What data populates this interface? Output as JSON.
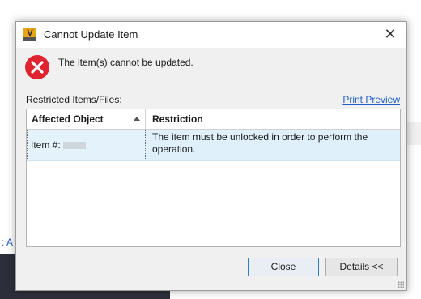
{
  "background": {
    "left_text": ":  A"
  },
  "dialog": {
    "title": "Cannot Update Item",
    "app_icon_letter": "V",
    "close_glyph": "✕",
    "message": "The item(s) cannot be updated.",
    "restricted_label": "Restricted Items/Files:",
    "print_preview": "Print Preview",
    "grid": {
      "columns": [
        "Affected Object",
        "Restriction"
      ],
      "rows": [
        {
          "affected_object": "Item #:",
          "restriction": "The item must be unlocked in order to perform the operation."
        }
      ]
    },
    "buttons": {
      "close": "Close",
      "details": "Details <<"
    }
  },
  "colors": {
    "accent": "#1e60c8",
    "error": "#e0242f",
    "selection": "#dff0fb"
  },
  "icons": [
    "app-logo-icon",
    "close-icon",
    "error-icon",
    "sort-ascending-icon",
    "resize-grip-icon"
  ]
}
